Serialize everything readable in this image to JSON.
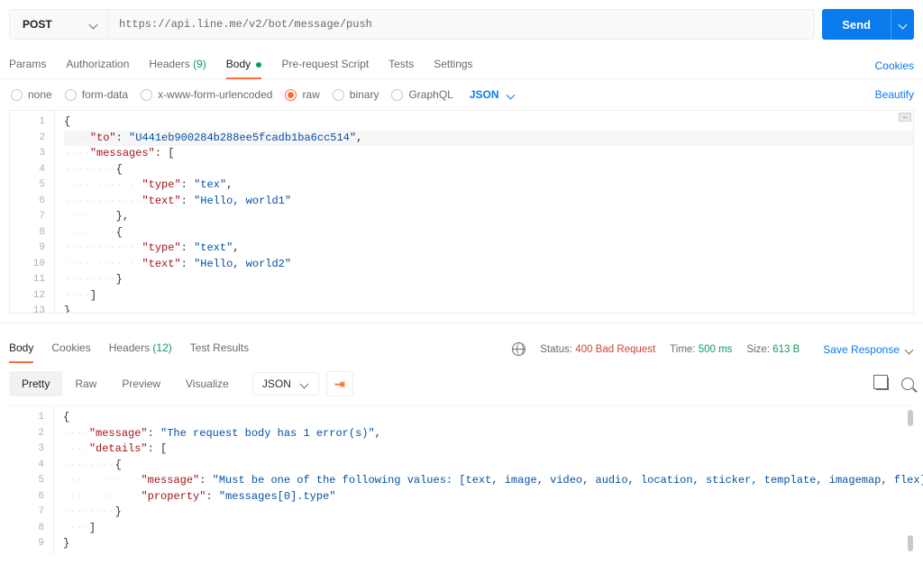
{
  "request": {
    "method": "POST",
    "url": "https://api.line.me/v2/bot/message/push",
    "send_label": "Send",
    "tabs": {
      "params": "Params",
      "auth": "Authorization",
      "headers_label": "Headers",
      "headers_count": "(9)",
      "body": "Body",
      "prerequest": "Pre-request Script",
      "tests": "Tests",
      "settings": "Settings"
    },
    "cookies_link": "Cookies",
    "body_types": {
      "none": "none",
      "formdata": "form-data",
      "xwww": "x-www-form-urlencoded",
      "raw": "raw",
      "binary": "binary",
      "graphql": "GraphQL"
    },
    "raw_lang": "JSON",
    "beautify": "Beautify"
  },
  "request_body_json": {
    "to": "U441eb900284b288ee5fcadb1ba6cc514",
    "messages": [
      {
        "type": "tex",
        "text": "Hello, world1"
      },
      {
        "type": "text",
        "text": "Hello, world2"
      }
    ]
  },
  "response": {
    "tabs": {
      "body": "Body",
      "cookies": "Cookies",
      "headers_label": "Headers",
      "headers_count": "(12)",
      "test_results": "Test Results"
    },
    "status_label": "Status:",
    "status_value": "400 Bad Request",
    "time_label": "Time:",
    "time_value": "500 ms",
    "size_label": "Size:",
    "size_value": "613 B",
    "save_response": "Save Response",
    "view_tabs": {
      "pretty": "Pretty",
      "raw": "Raw",
      "preview": "Preview",
      "visualize": "Visualize"
    },
    "body_lang": "JSON"
  },
  "response_body_json": {
    "message": "The request body has 1 error(s)",
    "details": [
      {
        "message": "Must be one of the following values: [text, image, video, audio, location, sticker, template, imagemap, flex]",
        "property": "messages[0].type"
      }
    ]
  }
}
